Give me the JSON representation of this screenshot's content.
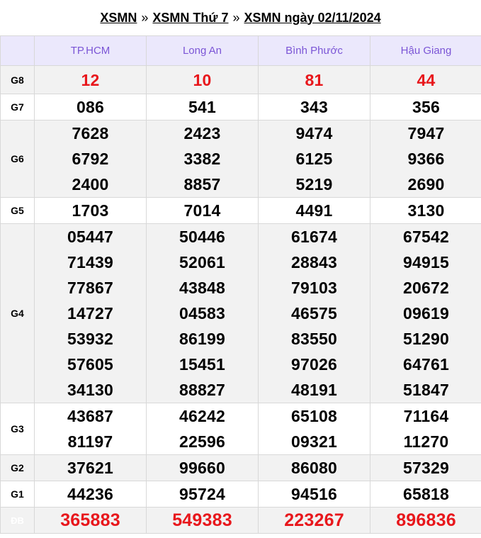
{
  "breadcrumb": {
    "items": [
      "XSMN",
      "XSMN Thứ 7",
      "XSMN ngày 02/11/2024"
    ],
    "separator": "»"
  },
  "provinces": [
    "TP.HCM",
    "Long An",
    "Bình Phước",
    "Hậu Giang"
  ],
  "prizes": [
    {
      "label": "G8",
      "values": [
        [
          "12"
        ],
        [
          "10"
        ],
        [
          "81"
        ],
        [
          "44"
        ]
      ]
    },
    {
      "label": "G7",
      "values": [
        [
          "086"
        ],
        [
          "541"
        ],
        [
          "343"
        ],
        [
          "356"
        ]
      ]
    },
    {
      "label": "G6",
      "values": [
        [
          "7628",
          "6792",
          "2400"
        ],
        [
          "2423",
          "3382",
          "8857"
        ],
        [
          "9474",
          "6125",
          "5219"
        ],
        [
          "7947",
          "9366",
          "2690"
        ]
      ]
    },
    {
      "label": "G5",
      "values": [
        [
          "1703"
        ],
        [
          "7014"
        ],
        [
          "4491"
        ],
        [
          "3130"
        ]
      ]
    },
    {
      "label": "G4",
      "values": [
        [
          "05447",
          "71439",
          "77867",
          "14727",
          "53932",
          "57605",
          "34130"
        ],
        [
          "50446",
          "52061",
          "43848",
          "04583",
          "86199",
          "15451",
          "88827"
        ],
        [
          "61674",
          "28843",
          "79103",
          "46575",
          "83550",
          "97026",
          "48191"
        ],
        [
          "67542",
          "94915",
          "20672",
          "09619",
          "51290",
          "64761",
          "51847"
        ]
      ]
    },
    {
      "label": "G3",
      "values": [
        [
          "43687",
          "81197"
        ],
        [
          "46242",
          "22596"
        ],
        [
          "65108",
          "09321"
        ],
        [
          "71164",
          "11270"
        ]
      ]
    },
    {
      "label": "G2",
      "values": [
        [
          "37621"
        ],
        [
          "99660"
        ],
        [
          "86080"
        ],
        [
          "57329"
        ]
      ]
    },
    {
      "label": "G1",
      "values": [
        [
          "44236"
        ],
        [
          "95724"
        ],
        [
          "94516"
        ],
        [
          "65818"
        ]
      ]
    },
    {
      "label": "ĐB",
      "values": [
        [
          "365883"
        ],
        [
          "549383"
        ],
        [
          "223267"
        ],
        [
          "896836"
        ]
      ]
    }
  ],
  "colors": {
    "accent_red": "#e8171c",
    "header_purple": "#7b55d6",
    "header_bg": "#ebe8fc"
  }
}
